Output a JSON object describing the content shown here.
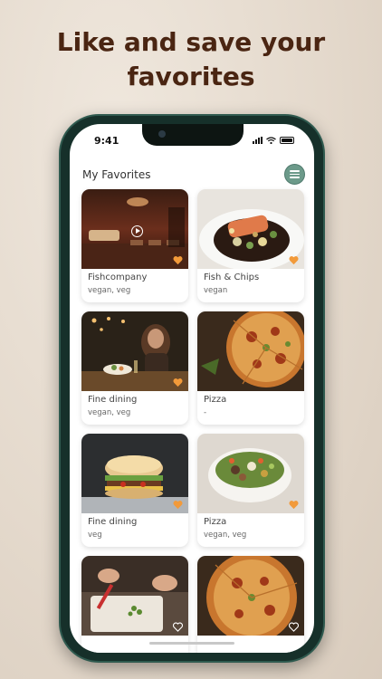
{
  "headline": "Like and save your favorites",
  "status": {
    "time": "9:41"
  },
  "header": {
    "title": "My Favorites",
    "menu_icon": "hamburger-menu-icon"
  },
  "favorites": [
    {
      "name": "Fishcompany",
      "tags": "vegan, veg",
      "favorited": true,
      "has_video": true
    },
    {
      "name": "Fish & Chips",
      "tags": "vegan",
      "favorited": true,
      "has_video": false
    },
    {
      "name": "Fine dining",
      "tags": "vegan, veg",
      "favorited": true,
      "has_video": false
    },
    {
      "name": "Pizza",
      "tags": "-",
      "favorited": false,
      "has_video": false
    },
    {
      "name": "Fine dining",
      "tags": "veg",
      "favorited": true,
      "has_video": false
    },
    {
      "name": "Pizza",
      "tags": "vegan, veg",
      "favorited": true,
      "has_video": false
    },
    {
      "name": "",
      "tags": "",
      "favorited": false,
      "has_video": false
    },
    {
      "name": "",
      "tags": "",
      "favorited": false,
      "has_video": false
    }
  ],
  "colors": {
    "headline": "#4a2512",
    "accent": "#6c9a8a",
    "heart_filled": "#f29a3a",
    "frame": "#16302a"
  }
}
